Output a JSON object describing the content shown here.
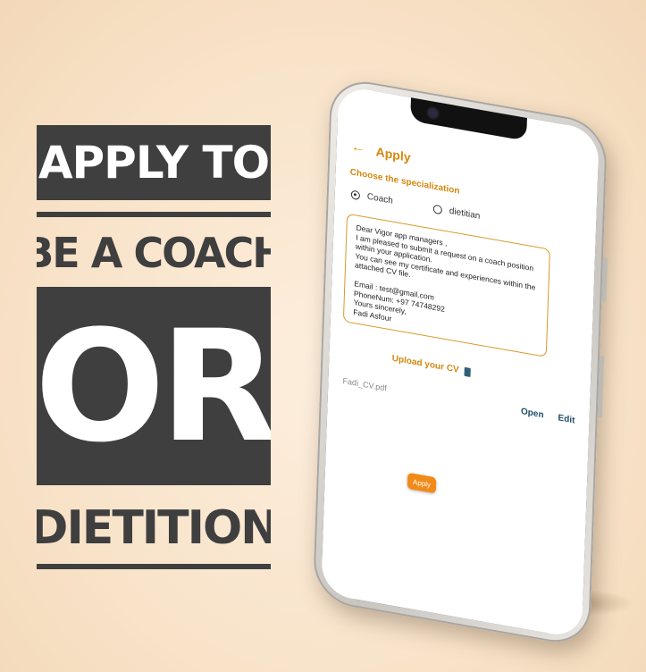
{
  "promo": {
    "line1": "APPLY TO",
    "line2": "BE A COACH",
    "line3": "OR",
    "line4": "DIETITION"
  },
  "app": {
    "title": "Apply",
    "back_icon": "arrow-left-icon",
    "specialization_label": "Choose the specialization",
    "options": [
      {
        "label": "Coach",
        "selected": true
      },
      {
        "label": "dietitian",
        "selected": false
      }
    ],
    "letter": "Dear Vigor app managers ,\nI am pleased to submit a request on a coach position within your application.\nYou can see my certificate and experiences within the attached CV file.\n\nEmail : test@gmail.com\nPhoneNum: +97 74748292\nYours sincerely,\nFadi Asfour",
    "upload_label": "Upload your CV",
    "upload_icon": "file-icon",
    "file_name": "Fadi_CV.pdf",
    "open_label": "Open",
    "edit_label": "Edit",
    "apply_label": "Apply"
  },
  "colors": {
    "accent": "#d4880f",
    "button": "#f28a18",
    "banner": "#3f3f3f",
    "background": "#f8e3c9"
  }
}
